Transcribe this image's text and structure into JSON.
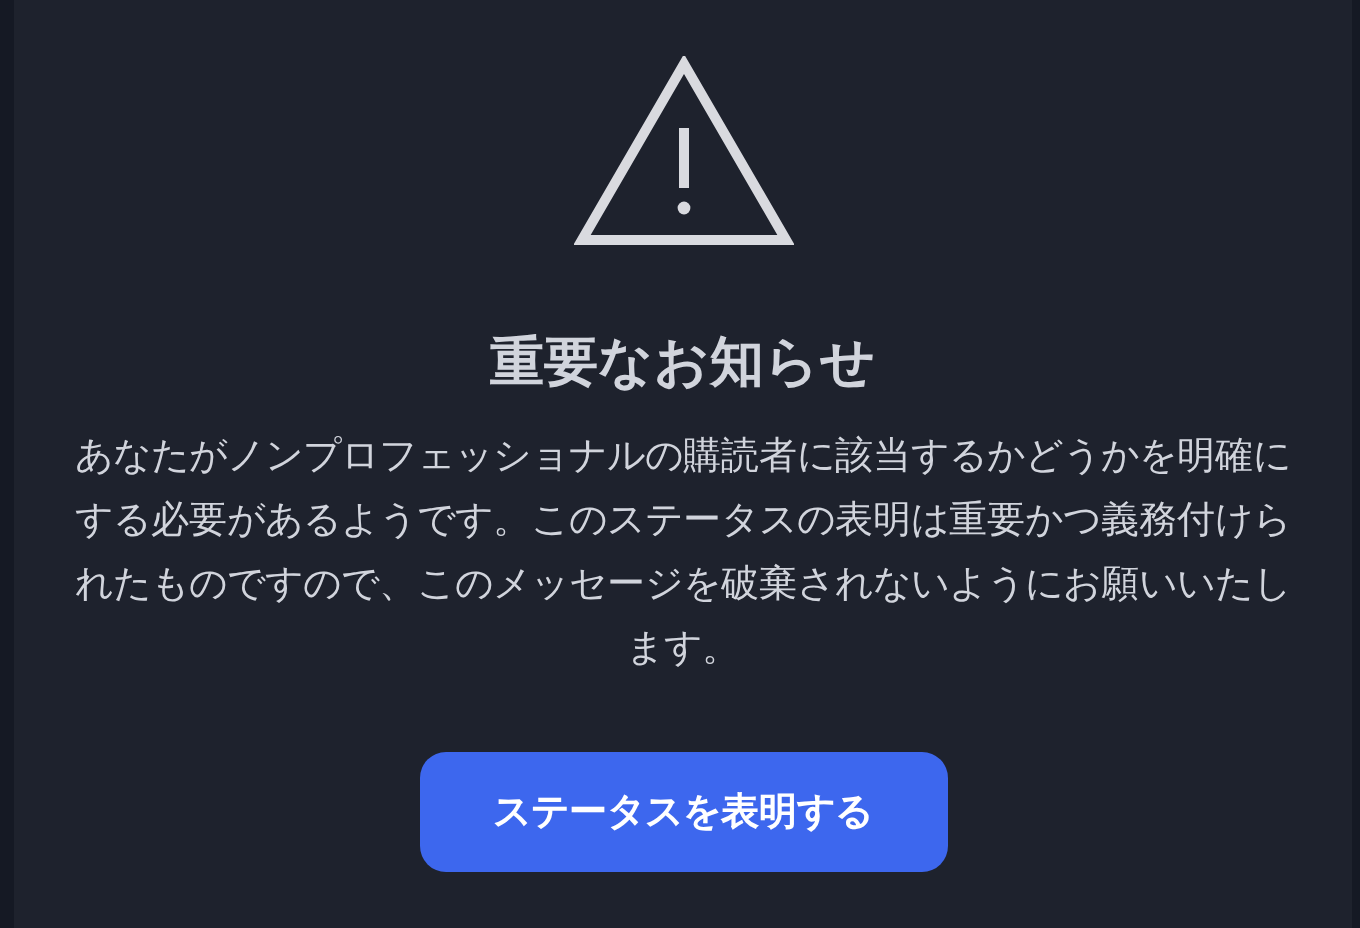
{
  "dialog": {
    "title": "重要なお知らせ",
    "message": "あなたがノンプロフェッショナルの購読者に該当するかどうかを明確にする必要があるようです。このステータスの表明は重要かつ義務付けられたものですので、このメッセージを破棄されないようにお願いいたします。",
    "button": "ステータスを表明する"
  }
}
